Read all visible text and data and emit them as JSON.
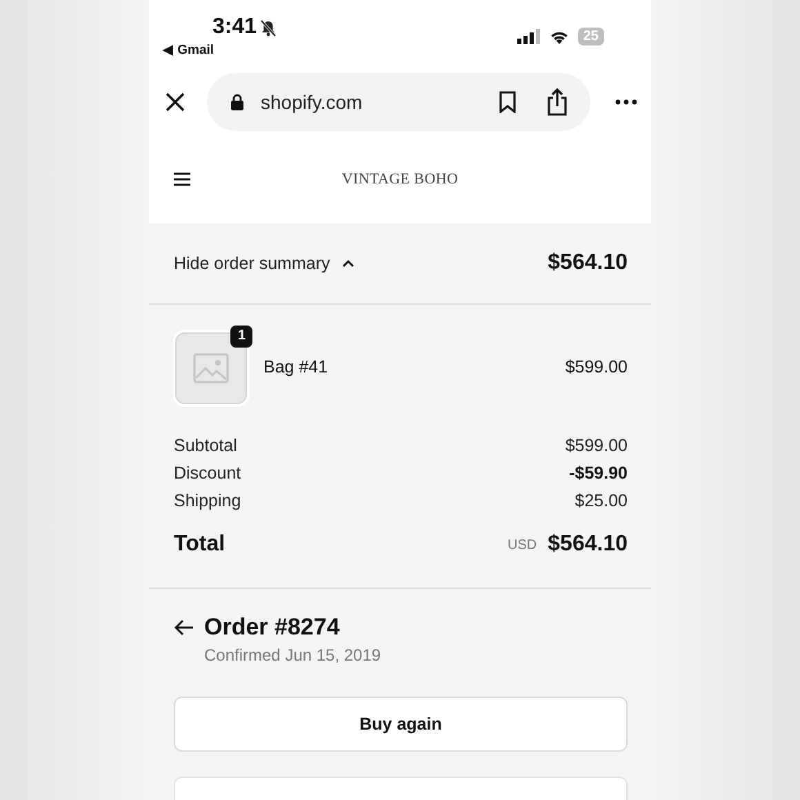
{
  "status_bar": {
    "time": "3:41",
    "back_app": "◀ Gmail",
    "battery": "25",
    "silent": true
  },
  "browser": {
    "url": "shopify.com"
  },
  "store": {
    "name": "VINTAGE BOHO"
  },
  "summary": {
    "toggle_label": "Hide order summary",
    "expanded": true,
    "total": "$564.10"
  },
  "items": [
    {
      "name": "Bag #41",
      "price": "$599.00",
      "quantity": "1"
    }
  ],
  "lines": [
    {
      "label": "Subtotal",
      "value": "$599.00",
      "kind": "charge"
    },
    {
      "label": "Discount",
      "value": "-$59.90",
      "kind": "discount"
    },
    {
      "label": "Shipping",
      "value": "$25.00",
      "kind": "charge"
    }
  ],
  "total": {
    "label": "Total",
    "currency": "USD",
    "amount": "$564.10"
  },
  "order": {
    "title": "Order #8274",
    "date": "Confirmed Jun 15, 2019"
  },
  "buttons": [
    "Buy again"
  ]
}
